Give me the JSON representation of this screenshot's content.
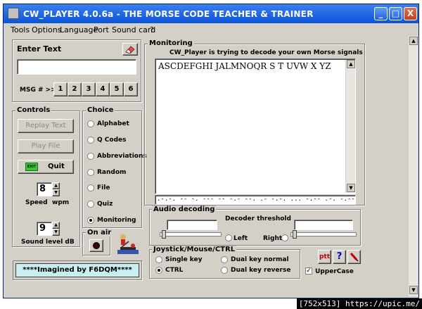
{
  "window": {
    "title": "CW_PLAYER 4.0.6a - THE MORSE CODE TEACHER & TRAINER",
    "minimize": "_",
    "maximize": "□",
    "close": "X"
  },
  "menu": [
    "Tools",
    "Options",
    "Language",
    "Port",
    "Sound card",
    "?"
  ],
  "enter_text": {
    "title": "Enter Text",
    "value": "",
    "msg_label": "MSG # >>",
    "msg_buttons": [
      "1",
      "2",
      "3",
      "4",
      "5",
      "6"
    ]
  },
  "controls": {
    "title": "Controls",
    "replay": "Replay Text",
    "play_file": "Play File",
    "quit": "Quit",
    "exit_badge": "EXIT",
    "speed_value": "8",
    "speed_label": "Speed",
    "speed_unit": "wpm",
    "sound_value": "9",
    "sound_label": "Sound level dB"
  },
  "choice": {
    "title": "Choice",
    "items": [
      {
        "label": "Alphabet",
        "selected": false
      },
      {
        "label": "Q Codes",
        "selected": false
      },
      {
        "label": "Abbreviations",
        "selected": false
      },
      {
        "label": "Random",
        "selected": false
      },
      {
        "label": "File",
        "selected": false
      },
      {
        "label": "Quiz",
        "selected": false
      },
      {
        "label": "Monitoring",
        "selected": true
      }
    ]
  },
  "on_air": {
    "label": "On air"
  },
  "credit": "****Imagined by F6DQM****",
  "monitoring": {
    "title": "Monitoring",
    "subtitle": "CW_Player is trying to decode your own Morse signals",
    "decoded": "ASCDEFGHI JALMNOQR S T UVW X YZ",
    "morse": ".-.-. -- -. --- -- -.- --. .- -.-. ... -.-- .-. -.-- -- ... -.-. ..-. ..-. ... --- .-- ---"
  },
  "audio": {
    "title": "Audio decoding",
    "threshold": "Decoder threshold",
    "left": "Left",
    "right": "Right"
  },
  "joystick": {
    "title": "Joystick/Mouse/CTRL",
    "items": [
      {
        "label": "Single key",
        "selected": false
      },
      {
        "label": "Dual key normal",
        "selected": false
      },
      {
        "label": "CTRL",
        "selected": true
      },
      {
        "label": "Dual key reverse",
        "selected": false
      }
    ]
  },
  "tool_buttons": {
    "ptt": "ptt",
    "help": "?"
  },
  "uppercase": {
    "label": "UpperCase",
    "checked": true
  },
  "watermark": "[752x513] https://upic.me/",
  "colors": {
    "title_bar": "#2a6ae6",
    "credit_bg": "#c8f0f0",
    "ptt_red": "#c00000",
    "help_blue": "#0000cc"
  }
}
